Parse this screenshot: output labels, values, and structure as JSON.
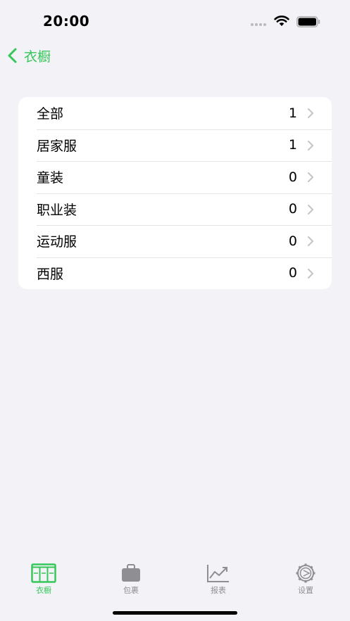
{
  "status": {
    "time": "20:00"
  },
  "nav": {
    "back_label": "衣橱"
  },
  "colors": {
    "accent": "#34c759",
    "inactive": "#8e8e93",
    "background": "#f2f2f7"
  },
  "categories": [
    {
      "label": "全部",
      "count": "1"
    },
    {
      "label": "居家服",
      "count": "1"
    },
    {
      "label": "童装",
      "count": "0"
    },
    {
      "label": "职业装",
      "count": "0"
    },
    {
      "label": "运动服",
      "count": "0"
    },
    {
      "label": "西服",
      "count": "0"
    }
  ],
  "tabs": [
    {
      "label": "衣橱",
      "icon": "wardrobe-icon",
      "active": true
    },
    {
      "label": "包裹",
      "icon": "bag-icon",
      "active": false
    },
    {
      "label": "报表",
      "icon": "chart-icon",
      "active": false
    },
    {
      "label": "设置",
      "icon": "gear-icon",
      "active": false
    }
  ]
}
